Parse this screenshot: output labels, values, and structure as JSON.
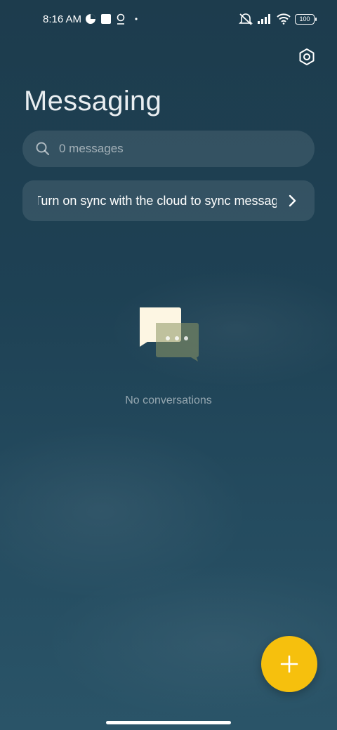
{
  "status_bar": {
    "time": "8:16 AM",
    "battery": "100"
  },
  "header": {
    "title": "Messaging",
    "settings_icon": "gear-hex-icon"
  },
  "search": {
    "placeholder": "0 messages",
    "value": "",
    "icon": "search-icon"
  },
  "sync_banner": {
    "text": "Turn on sync with the cloud to sync messages",
    "icon": "chevron-right-icon"
  },
  "empty_state": {
    "illustration": "chat-bubbles-icon",
    "text": "No conversations"
  },
  "fab": {
    "icon": "plus-icon",
    "color": "#f6c00d"
  },
  "colors": {
    "background_top": "#1d3c4d",
    "background_bottom": "#2a5468",
    "accent": "#f6c00d"
  }
}
